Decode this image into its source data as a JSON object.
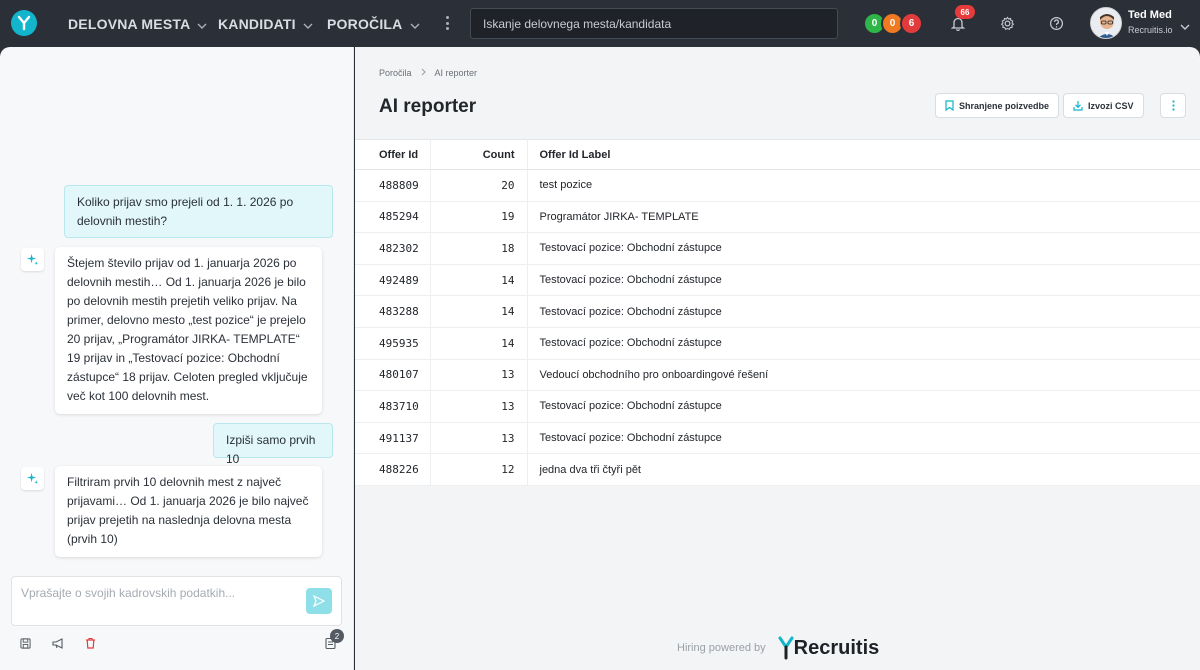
{
  "topbar": {
    "nav": [
      {
        "label": "DELOVNA MESTA"
      },
      {
        "label": "KANDIDATI"
      },
      {
        "label": "POROČILA"
      }
    ],
    "search_placeholder": "Iskanje delovnega mesta/kandidata",
    "status_dots": [
      {
        "value": "0",
        "color": "#2fb548"
      },
      {
        "value": "0",
        "color": "#f07a22"
      },
      {
        "value": "6",
        "color": "#e33b3b"
      }
    ],
    "notifications_count": "66",
    "user": {
      "name": "Ted Med",
      "org": "Recruitis.io"
    }
  },
  "chat": {
    "messages": [
      {
        "role": "user",
        "text": "Koliko prijav smo prejeli od 1. 1. 2026 po delovnih mestih?"
      },
      {
        "role": "ai",
        "text": "Štejem število prijav od 1. januarja 2026 po delovnih mestih… Od 1. januarja 2026 je bilo po delovnih mestih prejetih veliko prijav. Na primer, delovno mesto „test pozice“ je prejelo 20 prijav, „Programátor JIRKA- TEMPLATE“ 19 prijav in „Testovací pozice: Obchodní zástupce“ 18 prijav. Celoten pregled vključuje več kot 100 delovnih mest."
      },
      {
        "role": "user",
        "text": "Izpiši samo prvih 10"
      },
      {
        "role": "ai",
        "text": "Filtriram prvih 10 delovnih mest z največ prijavami… Od 1. januarja 2026 je bilo največ prijav prejetih na naslednja delovna mesta (prvih 10)"
      }
    ],
    "input_placeholder": "Vprašajte o svojih kadrovskih podatkih...",
    "history_count": "2"
  },
  "report": {
    "breadcrumb": [
      "Poročila",
      "AI reporter"
    ],
    "title": "AI reporter",
    "save_label": "Shranjene poizvedbe",
    "export_label": "Izvozi CSV",
    "columns": [
      "Offer Id",
      "Count",
      "Offer Id Label"
    ],
    "rows": [
      {
        "id": "488809",
        "count": "20",
        "label": "test pozice"
      },
      {
        "id": "485294",
        "count": "19",
        "label": "Programátor JIRKA- TEMPLATE"
      },
      {
        "id": "482302",
        "count": "18",
        "label": "Testovací pozice: Obchodní zástupce"
      },
      {
        "id": "492489",
        "count": "14",
        "label": "Testovací pozice: Obchodní zástupce"
      },
      {
        "id": "483288",
        "count": "14",
        "label": "Testovací pozice: Obchodní zástupce"
      },
      {
        "id": "495935",
        "count": "14",
        "label": "Testovací pozice: Obchodní zástupce"
      },
      {
        "id": "480107",
        "count": "13",
        "label": "Vedoucí obchodního pro onboardingové řešení"
      },
      {
        "id": "483710",
        "count": "13",
        "label": "Testovací pozice: Obchodní zástupce"
      },
      {
        "id": "491137",
        "count": "13",
        "label": "Testovací pozice: Obchodní zástupce"
      },
      {
        "id": "488226",
        "count": "12",
        "label": "jedna dva tři čtyři pět"
      }
    ],
    "footer_text": "Hiring powered by",
    "brand": "Recruitis"
  },
  "colors": {
    "accent": "#12b5cb",
    "topbar": "#2b3038"
  }
}
